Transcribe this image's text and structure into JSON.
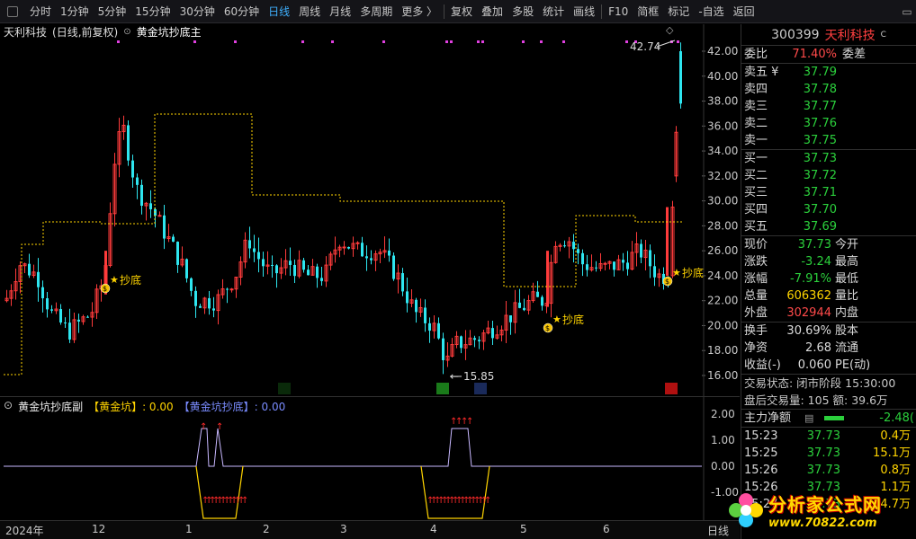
{
  "toolbar": {
    "tabs": [
      "分时",
      "1分钟",
      "5分钟",
      "15分钟",
      "30分钟",
      "60分钟",
      "日线",
      "周线",
      "月线",
      "多周期",
      "更多 〉",
      "复权",
      "叠加",
      "多股",
      "统计",
      "画线",
      "F10",
      "简框",
      "标记",
      "-自选",
      "返回"
    ],
    "active_tab": "日线"
  },
  "main": {
    "stock_label": "天利科技",
    "mode": "(日线,前复权)",
    "indicator": "黄金坑抄底主",
    "y_ticks": [
      "42.00",
      "40.00",
      "38.00",
      "36.00",
      "34.00",
      "32.00",
      "30.00",
      "28.00",
      "26.00",
      "24.00",
      "22.00",
      "20.00",
      "18.00",
      "16.00"
    ],
    "high_label": "42.74",
    "low_label": "15.85",
    "buy_label": "抄底",
    "markers": [
      "减",
      "跌",
      "财",
      "$",
      "涨榜"
    ]
  },
  "sub": {
    "name": "黄金坑抄底副",
    "s1": "【黄金坑】: 0.00",
    "s2": "【黄金坑抄底】: 0.00",
    "y_ticks": [
      "2.00",
      "1.00",
      "0.00",
      "-1.00"
    ]
  },
  "dates": [
    "2024年",
    "12",
    "1",
    "2",
    "3",
    "4",
    "5",
    "6",
    "日线"
  ],
  "quote": {
    "code": "300399",
    "name": "天利科技",
    "sup": "C",
    "weibi_label": "委比",
    "weibi": "71.40%",
    "weicha": "委差",
    "asks": [
      {
        "label": "卖五 ¥",
        "price": "37.79"
      },
      {
        "label": "卖四",
        "price": "37.78"
      },
      {
        "label": "卖三",
        "price": "37.77"
      },
      {
        "label": "卖二",
        "price": "37.76"
      },
      {
        "label": "卖一",
        "price": "37.75"
      }
    ],
    "bids": [
      {
        "label": "买一",
        "price": "37.73"
      },
      {
        "label": "买二",
        "price": "37.72"
      },
      {
        "label": "买三",
        "price": "37.71"
      },
      {
        "label": "买四",
        "price": "37.70"
      },
      {
        "label": "买五",
        "price": "37.69"
      }
    ],
    "stats": [
      {
        "l": "现价",
        "v": "37.73",
        "l2": "今开"
      },
      {
        "l": "涨跌",
        "v": "-3.24",
        "l2": "最高"
      },
      {
        "l": "涨幅",
        "v": "-7.91%",
        "l2": "最低"
      },
      {
        "l": "总量",
        "v": "606362",
        "l2": "量比"
      },
      {
        "l": "外盘",
        "v": "302944",
        "l2": "内盘"
      }
    ],
    "stats2": [
      {
        "l": "换手",
        "v": "30.69%",
        "l2": "股本"
      },
      {
        "l": "净资",
        "v": "2.68",
        "l2": "流通"
      },
      {
        "l": "收益(-)",
        "v": "0.060",
        "l2": "PE(动)"
      }
    ],
    "status1": "交易状态: 闭市阶段 15:30:00",
    "status2": "盘后交易量: 105  额: 39.6万",
    "flow_label": "主力净额",
    "flow_value": "-2.48(",
    "ticks": [
      {
        "t": "15:23",
        "p": "37.73",
        "v": "0.4万"
      },
      {
        "t": "15:25",
        "p": "37.73",
        "v": "15.1万"
      },
      {
        "t": "15:26",
        "p": "37.73",
        "v": "0.8万"
      },
      {
        "t": "15:26",
        "p": "37.73",
        "v": "1.1万"
      },
      {
        "t": "15:27",
        "p": "37.73",
        "v": "4.7万"
      }
    ]
  },
  "logo": {
    "t1": "分析家公式网",
    "t2": "www.70822.com"
  },
  "colors": {
    "up": "#ff3b3b",
    "down": "#2ee6f0",
    "accent": "#3fb1ff",
    "yellow": "#ffd400"
  }
}
